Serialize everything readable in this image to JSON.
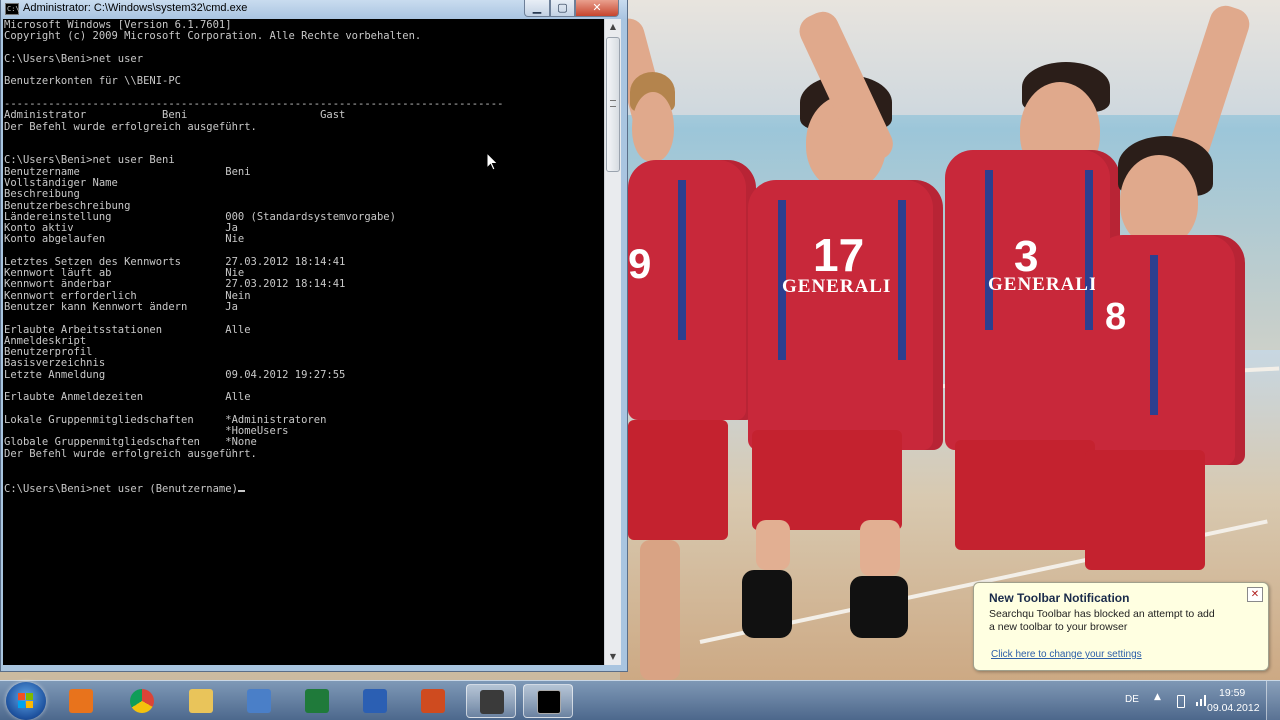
{
  "cmd": {
    "title": "Administrator: C:\\Windows\\system32\\cmd.exe",
    "min_glyph": "▁",
    "max_glyph": "▢",
    "close_glyph": "✕",
    "icon_text": "C:\\",
    "prompt_text": "C:\\Users\\Beni>net user (Benutzername)",
    "lines": [
      "Microsoft Windows [Version 6.1.7601]",
      "Copyright (c) 2009 Microsoft Corporation. Alle Rechte vorbehalten.",
      "",
      "C:\\Users\\Beni>net user",
      "",
      "Benutzerkonten für \\\\BENI-PC",
      "",
      "-------------------------------------------------------------------------------",
      "Administrator            Beni                     Gast",
      "Der Befehl wurde erfolgreich ausgeführt.",
      "",
      "",
      "C:\\Users\\Beni>net user Beni",
      "Benutzername                       Beni",
      "Vollständiger Name",
      "Beschreibung",
      "Benutzerbeschreibung",
      "Ländereinstellung                  000 (Standardsystemvorgabe)",
      "Konto aktiv                        Ja",
      "Konto abgelaufen                   Nie",
      "",
      "Letztes Setzen des Kennworts       27.03.2012 18:14:41",
      "Kennwort läuft ab                  Nie",
      "Kennwort änderbar                  27.03.2012 18:14:41",
      "Kennwort erforderlich              Nein",
      "Benutzer kann Kennwort ändern      Ja",
      "",
      "Erlaubte Arbeitsstationen          Alle",
      "Anmeldeskript",
      "Benutzerprofil",
      "Basisverzeichnis",
      "Letzte Anmeldung                   09.04.2012 19:27:55",
      "",
      "Erlaubte Anmeldezeiten             Alle",
      "",
      "Lokale Gruppenmitgliedschaften     *Administratoren",
      "                                   *HomeUsers",
      "Globale Gruppenmitgliedschaften    *None",
      "Der Befehl wurde erfolgreich ausgeführt.",
      "",
      ""
    ]
  },
  "wallpaper": {
    "jersey_sponsor": "GENERALI",
    "numbers": [
      "9",
      "17",
      "3",
      "8"
    ]
  },
  "notification": {
    "title": "New Toolbar Notification",
    "body": "Searchqu Toolbar has blocked an attempt to add a new toolbar to your browser",
    "link": "Click here to change your settings",
    "close_glyph": "✕"
  },
  "taskbar": {
    "items": [
      {
        "name": "media-player-icon",
        "color": "#e8731c"
      },
      {
        "name": "chrome-icon",
        "color": "#d9342b"
      },
      {
        "name": "explorer-folder-icon",
        "color": "#e9c45a"
      },
      {
        "name": "control-panel-icon",
        "color": "#4a7fc8"
      },
      {
        "name": "excel-icon",
        "color": "#1f7a3a"
      },
      {
        "name": "word-icon",
        "color": "#2b5fb3"
      },
      {
        "name": "powerpoint-icon",
        "color": "#cf4b1f"
      },
      {
        "name": "hypercam-icon",
        "color": "#3a3a3a"
      },
      {
        "name": "cmd-icon",
        "color": "#000000"
      }
    ],
    "language": "DE",
    "tray_arrow": "▲",
    "time": "19:59",
    "date": "09.04.2012"
  }
}
